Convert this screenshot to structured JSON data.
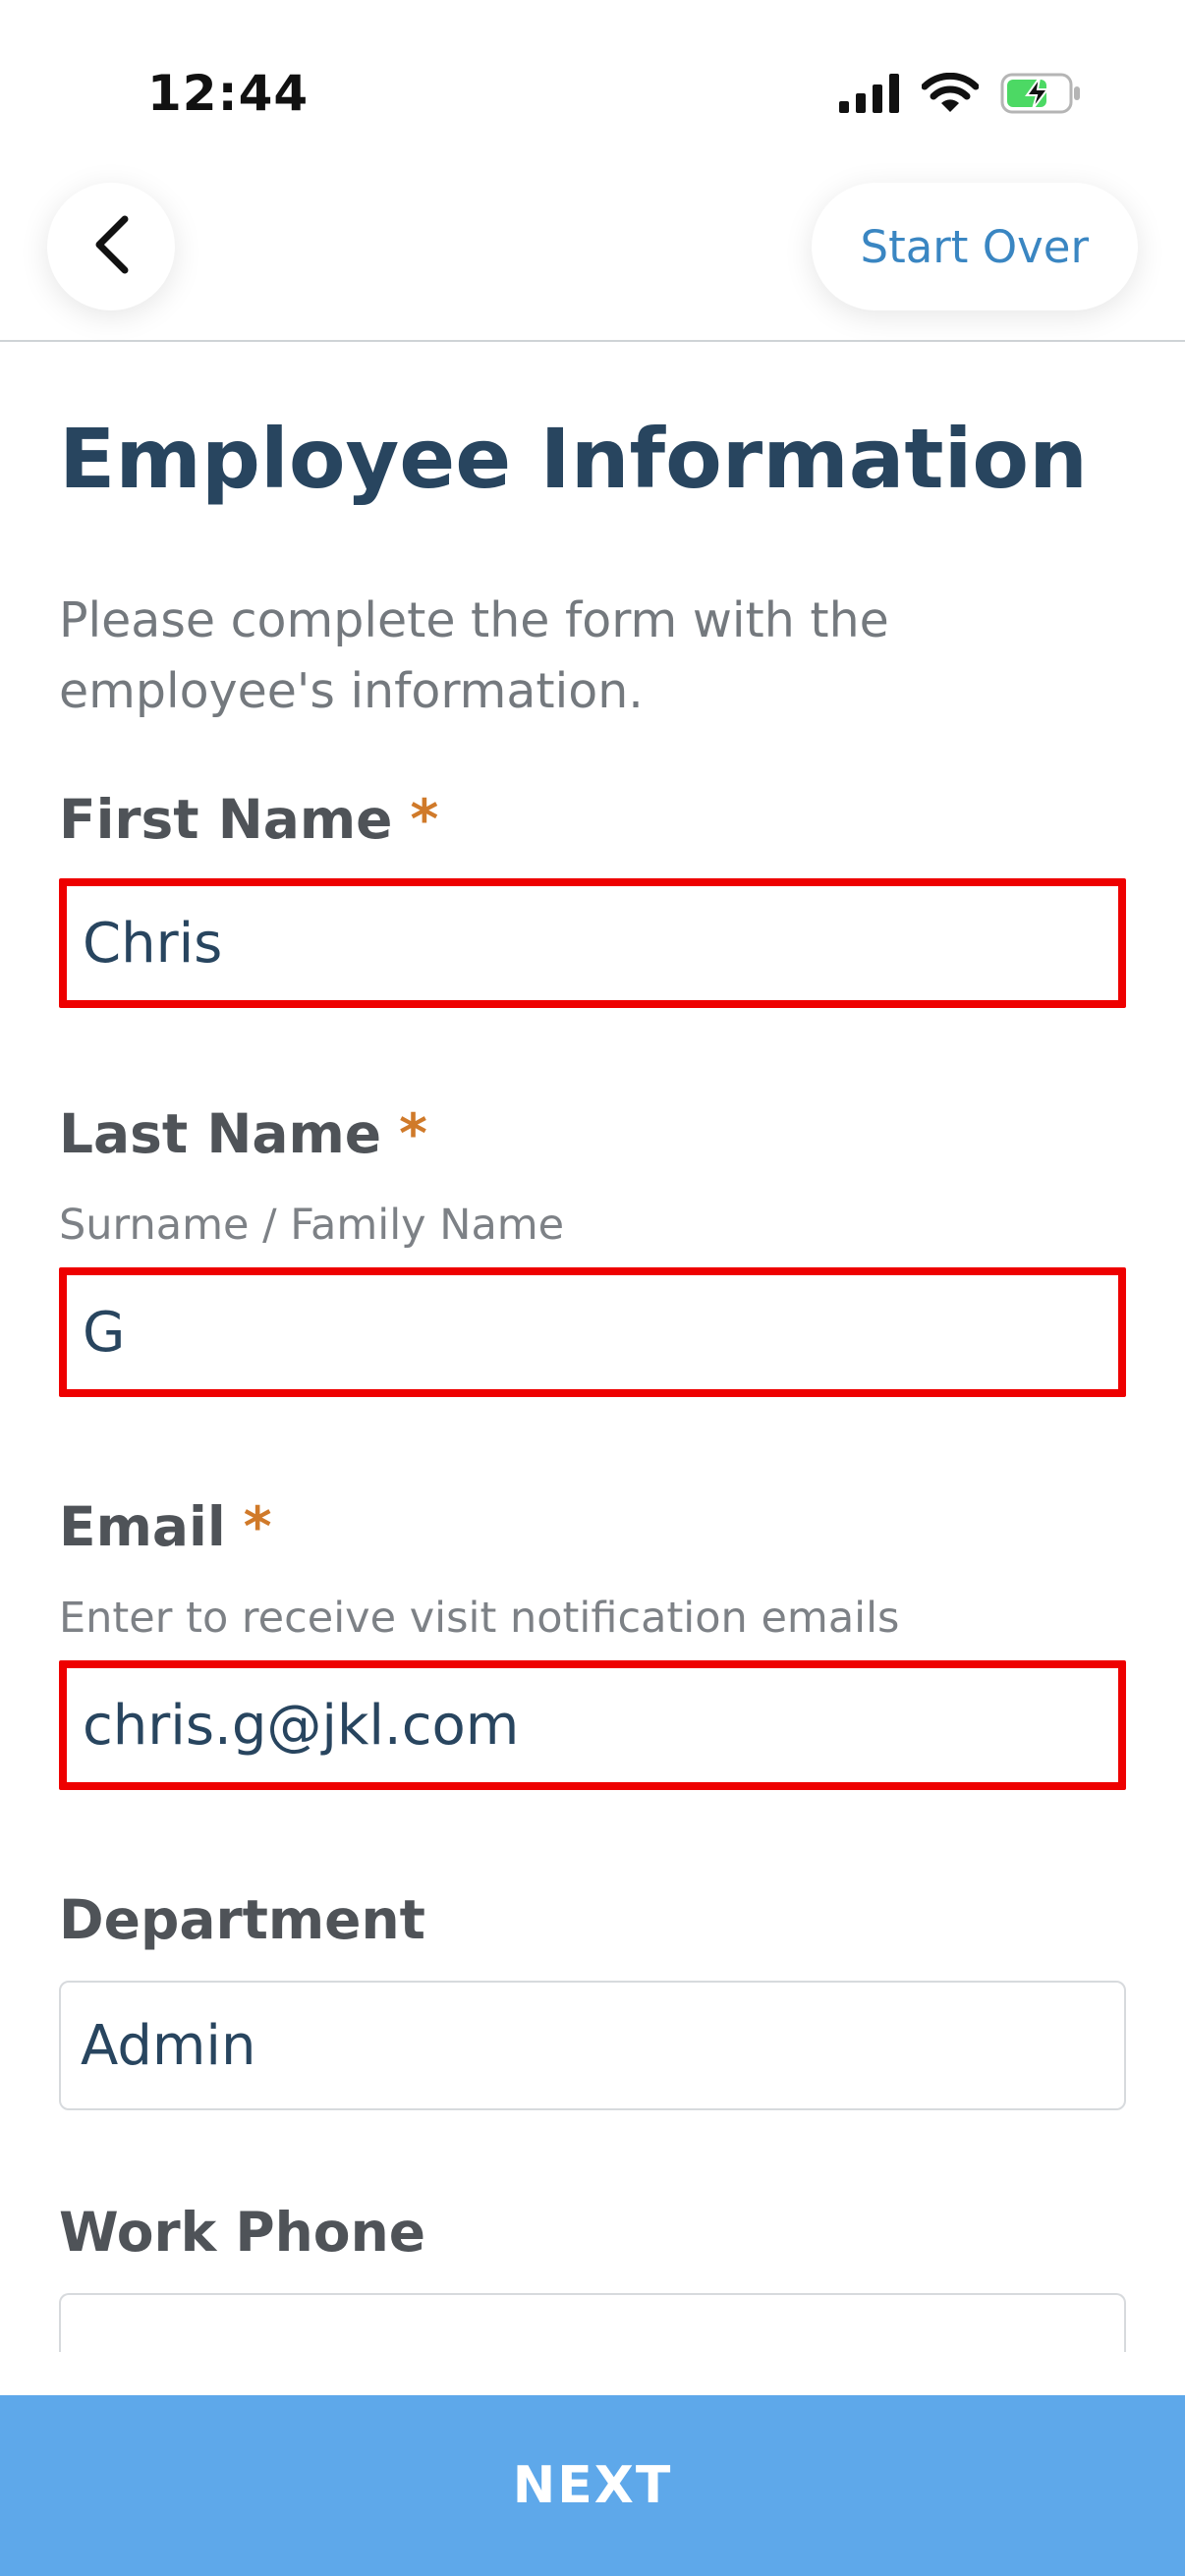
{
  "status_bar": {
    "time": "12:44",
    "icons": [
      "signal-icon",
      "wifi-icon",
      "battery-charging-icon"
    ],
    "battery_color": "#4cd964"
  },
  "header": {
    "back_icon": "chevron-left-icon",
    "start_over_label": "Start Over",
    "accent_color": "#3a86c2"
  },
  "page": {
    "title": "Employee Information",
    "subtitle": "Please complete the form with the employee's information."
  },
  "form": {
    "required_marker": "*",
    "first_name": {
      "label": "First Name",
      "value": "Chris"
    },
    "last_name": {
      "label": "Last Name",
      "hint": "Surname / Family Name",
      "value": "G"
    },
    "email": {
      "label": "Email",
      "hint": "Enter to receive visit notification emails",
      "value": "chris.g@jkl.com"
    },
    "department": {
      "label": "Department",
      "value": "Admin"
    },
    "work_phone": {
      "label": "Work Phone",
      "value": ""
    }
  },
  "footer": {
    "next_label": "NEXT",
    "button_color": "#5ea8ea"
  }
}
